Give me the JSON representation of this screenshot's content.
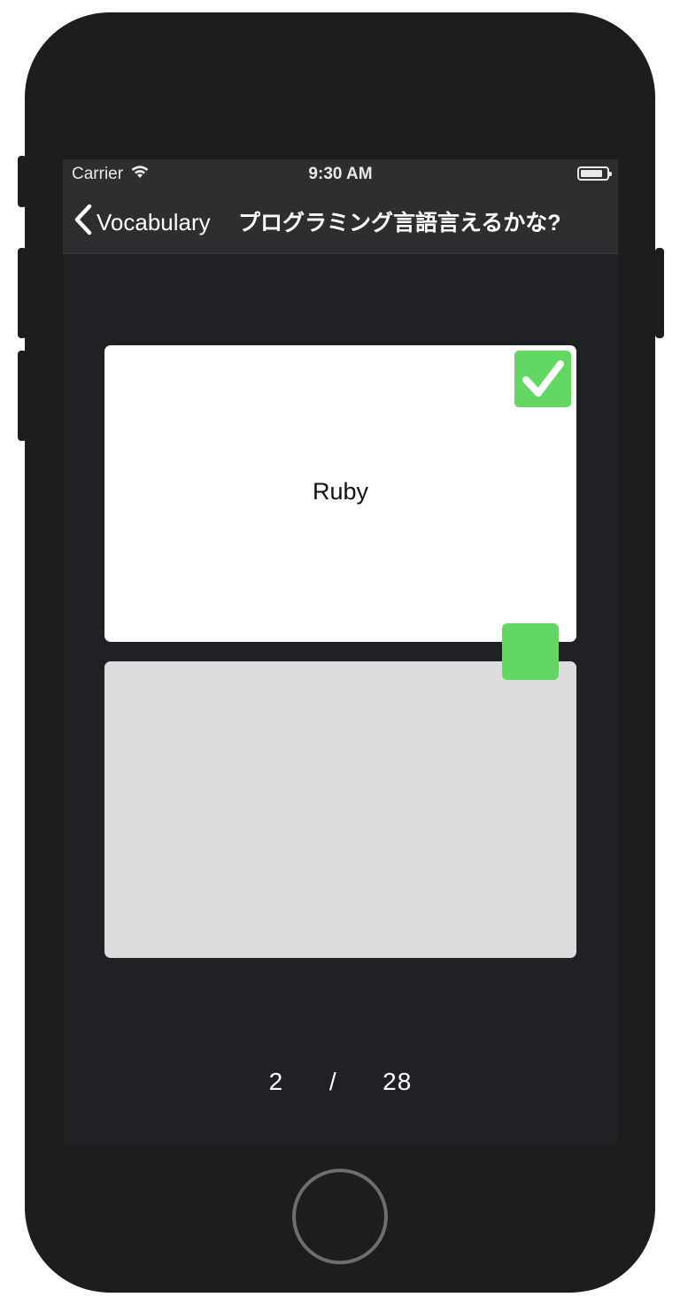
{
  "status_bar": {
    "carrier": "Carrier",
    "time": "9:30 AM"
  },
  "nav_bar": {
    "back_label": "Vocabulary",
    "title": "プログラミング言語言えるかな?"
  },
  "card": {
    "word": "Ruby"
  },
  "counter": {
    "current": "2",
    "separator": "/",
    "total": "28"
  },
  "colors": {
    "accent_green": "#63d764",
    "screen_bg": "#202124",
    "bar_bg": "#2d2e30",
    "card_front": "#ffffff",
    "card_back": "#dddddd"
  },
  "icons": {
    "back": "chevron-left-icon",
    "wifi": "wifi-icon",
    "battery": "battery-icon",
    "check": "checkmark-icon"
  }
}
